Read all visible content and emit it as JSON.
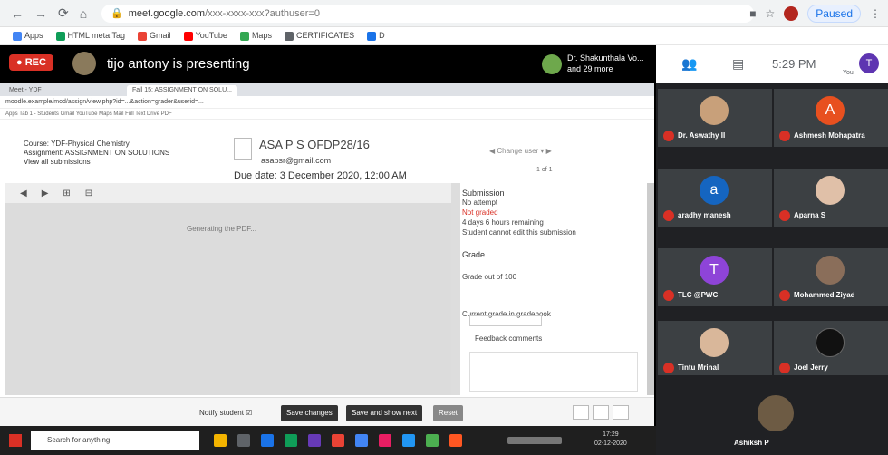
{
  "browser": {
    "url_host": "meet.google.com",
    "url_rest": "/xxx-xxxx-xxx?authuser=0",
    "paused_label": "Paused",
    "bookmarks": [
      "Apps",
      "HTML meta Tag",
      "Gmail",
      "YouTube",
      "Maps",
      "CERTIFICATES",
      "D"
    ]
  },
  "meet": {
    "rec_label": "REC",
    "presenting": "tijo antony is presenting",
    "pinned_name": "Dr. Shakunthala Vo...",
    "pinned_sub": "and 29 more",
    "time": "5:29 PM",
    "you_initial": "T",
    "you_label": "You"
  },
  "shared": {
    "tab1": "Meet - YDF",
    "tab2": "Fall 15: ASSIGNMENT ON SOLU...",
    "address": "moodle.example/mod/assign/view.php?id=...&action=grader&userid=...",
    "bookmarks_line": "Apps   Tab 1 - Students   Gmail   YouTube   Maps   Mail   Full Text   Drive   PDF",
    "course": "Course: YDF-Physical Chemistry",
    "assignment": "Assignment: ASSIGNMENT ON SOLUTIONS",
    "view_all": "View all submissions",
    "student_name": "ASA P S OFDP28/16",
    "student_email": "asapsr@gmail.com",
    "due": "Due date: 3 December 2020, 12:00 AM",
    "change_user": "Change user",
    "page_of": "1 of 1",
    "pdf_status": "Generating the PDF...",
    "submission_h": "Submission",
    "sub_lines": [
      "No attempt",
      "Not graded",
      "4 days 6 hours remaining",
      "Student cannot edit this submission"
    ],
    "grade_h": "Grade",
    "grade_out": "Grade out of 100",
    "current_grade": "Current grade in gradebook",
    "feedback": "Feedback comments",
    "notify": "Notify student",
    "save": "Save changes",
    "save_next": "Save and show next",
    "reset": "Reset"
  },
  "participants": [
    {
      "name": "Dr. Aswathy II",
      "initial": "",
      "color": "#c8a07a"
    },
    {
      "name": "Ashmesh Mohapatra",
      "initial": "A",
      "color": "#e8501f"
    },
    {
      "name": "aradhy manesh",
      "initial": "a",
      "color": "#1565c0"
    },
    {
      "name": "Aparna S",
      "initial": "",
      "color": "#e0c0a8"
    },
    {
      "name": "TLC @PWC",
      "initial": "T",
      "color": "#8e44d8"
    },
    {
      "name": "Mohammed Ziyad",
      "initial": "",
      "color": "#8a6e5a"
    },
    {
      "name": "Tintu Mrinal",
      "initial": "",
      "color": "#d9b79a"
    },
    {
      "name": "Joel Jerry",
      "initial": "",
      "color": "#111111"
    }
  ],
  "self_name": "Ashiksh P",
  "taskbar": {
    "search": "Search for anything",
    "clock_time": "17:29",
    "clock_date": "02-12-2020"
  }
}
